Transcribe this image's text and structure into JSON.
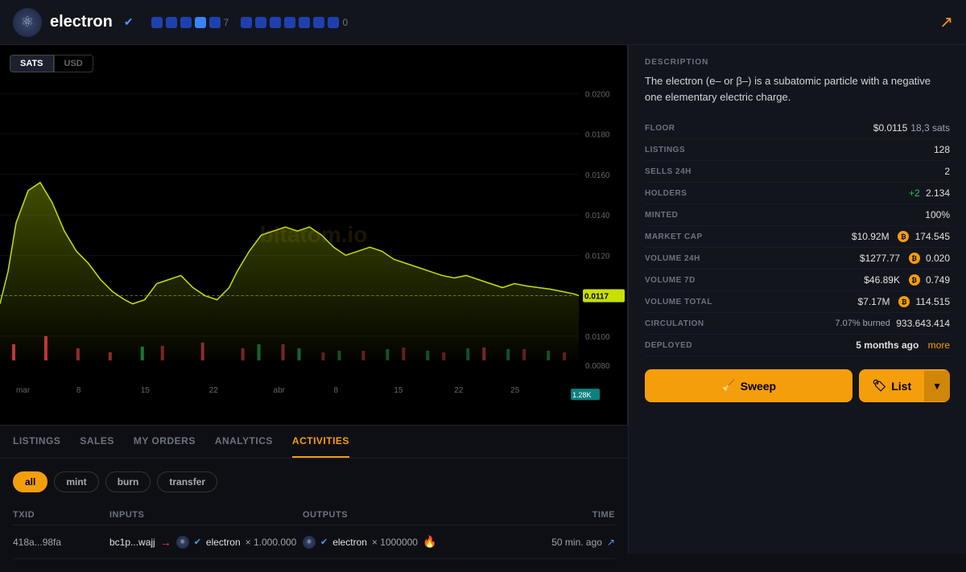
{
  "header": {
    "app_name": "electron",
    "verified": true,
    "breadcrumb_num1": "7",
    "breadcrumb_num2": "0",
    "share_icon": "↗"
  },
  "chart": {
    "toggle": {
      "sats_label": "SATS",
      "usd_label": "USD",
      "active": "SATS"
    },
    "watermark": "bitatom.io",
    "y_labels": [
      "0.0200",
      "0.0180",
      "0.0160",
      "0.0140",
      "0.0120",
      "0.0117",
      "0.0100",
      "0.0080"
    ],
    "current_price": "0.0117",
    "volume_label": "1.28K",
    "x_labels": [
      "mar",
      "8",
      "15",
      "22",
      "abr",
      "8",
      "15",
      "22",
      "25"
    ]
  },
  "tabs": [
    {
      "id": "listings",
      "label": "LISTINGS",
      "active": false
    },
    {
      "id": "sales",
      "label": "SALES",
      "active": false
    },
    {
      "id": "my-orders",
      "label": "MY ORDERS",
      "active": false
    },
    {
      "id": "analytics",
      "label": "ANALYTICS",
      "active": false
    },
    {
      "id": "activities",
      "label": "ACTIVITIES",
      "active": true
    }
  ],
  "filters": [
    {
      "id": "all",
      "label": "all",
      "active": true
    },
    {
      "id": "mint",
      "label": "mint",
      "active": false
    },
    {
      "id": "burn",
      "label": "burn",
      "active": false
    },
    {
      "id": "transfer",
      "label": "transfer",
      "active": false
    }
  ],
  "table": {
    "headers": [
      "TXID",
      "INPUTS",
      "OUTPUTS",
      "TIME"
    ],
    "rows": [
      {
        "txid": "418a...98fa",
        "input_address": "bc1p...wajj",
        "input_token": "electron",
        "input_amount": "× 1.000.000",
        "output_token": "electron",
        "output_amount": "× 1000000",
        "time": "50 min. ago"
      }
    ]
  },
  "sidebar": {
    "description_label": "DESCRIPTION",
    "description": "The electron (e– or β–) is a subatomic particle with a negative one elementary electric charge.",
    "stats": [
      {
        "key": "FLOOR",
        "value": "$0.0115",
        "extra": "18,3 sats"
      },
      {
        "key": "LISTINGS",
        "value": "128"
      },
      {
        "key": "SELLS 24H",
        "value": "2"
      },
      {
        "key": "HOLDERS",
        "value": "2.134",
        "prefix": "+2"
      },
      {
        "key": "MINTED",
        "value": "100%"
      },
      {
        "key": "MARKET CAP",
        "value": "$10.92M",
        "btc": "174.545"
      },
      {
        "key": "VOLUME 24H",
        "value": "$1277.77",
        "btc": "0.020"
      },
      {
        "key": "VOLUME 7D",
        "value": "$46.89K",
        "btc": "0.749"
      },
      {
        "key": "VOLUME TOTAL",
        "value": "$7.17M",
        "btc": "114.515"
      },
      {
        "key": "CIRCULATION",
        "value": "933.643.414",
        "prefix": "7.07% burned"
      },
      {
        "key": "DEPLOYED",
        "value": "5 months ago",
        "more": "more"
      }
    ],
    "buttons": {
      "sweep": "Sweep",
      "list": "List"
    }
  }
}
